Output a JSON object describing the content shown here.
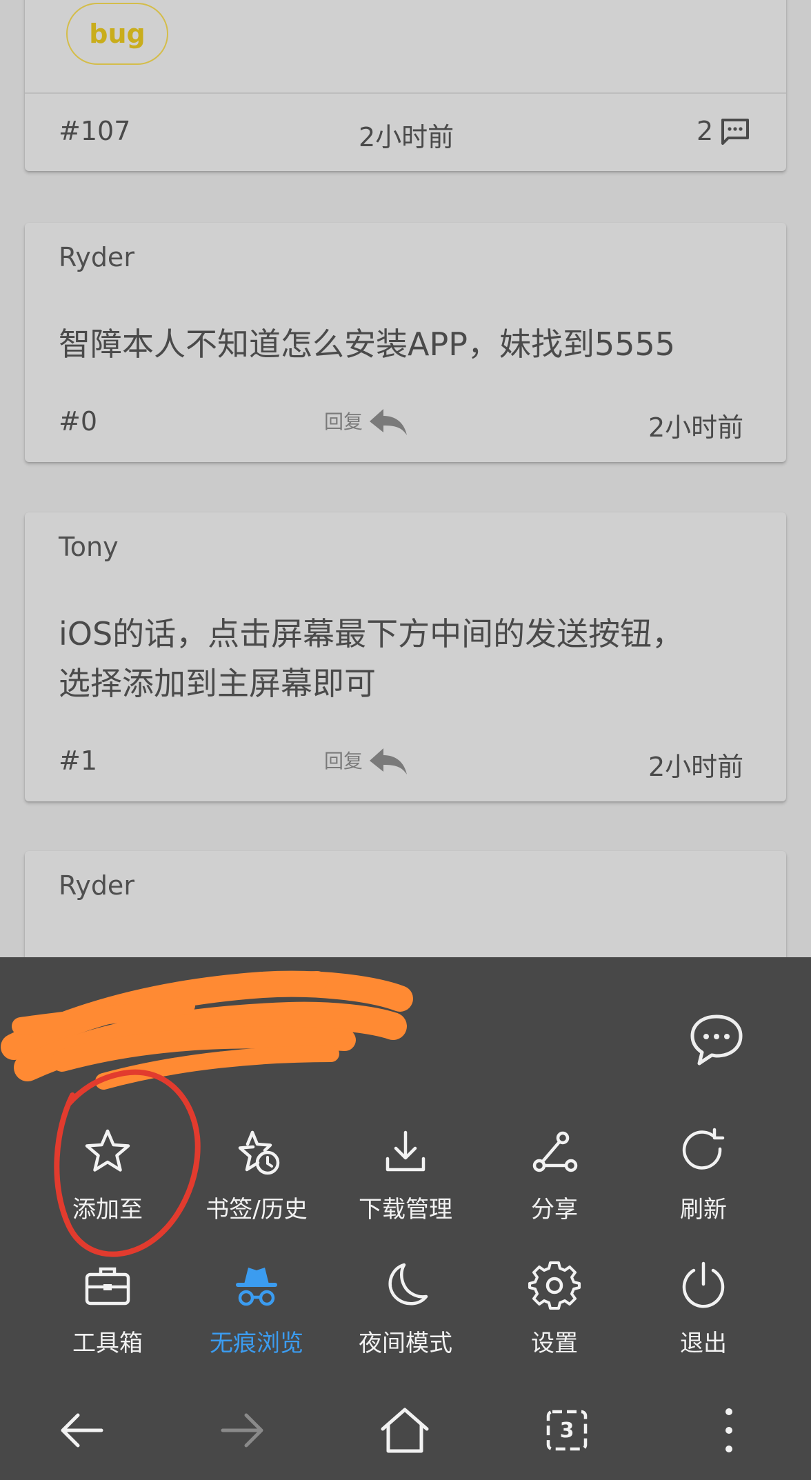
{
  "issue_card": {
    "tag": "bug",
    "number": "#107",
    "time": "2小时前",
    "comments": "2"
  },
  "comments": [
    {
      "author": "Ryder",
      "text_lines": [
        "智障本人不知道怎么安装APP，妹找到5555"
      ],
      "number": "#0",
      "reply_label": "回复",
      "time": "2小时前"
    },
    {
      "author": "Tony",
      "text_lines": [
        "iOS的话，点击屏幕最下方中间的发送按钮，",
        "选择添加到主屏幕即可"
      ],
      "number": "#1",
      "reply_label": "回复",
      "time": "2小时前"
    },
    {
      "author": "Ryder"
    }
  ],
  "menu": {
    "row1": [
      {
        "label": "添加至",
        "icon": "star-icon"
      },
      {
        "label": "书签/历史",
        "icon": "bookmark-history-icon"
      },
      {
        "label": "下载管理",
        "icon": "download-icon"
      },
      {
        "label": "分享",
        "icon": "share-icon"
      },
      {
        "label": "刷新",
        "icon": "refresh-icon"
      }
    ],
    "row2": [
      {
        "label": "工具箱",
        "icon": "toolbox-icon"
      },
      {
        "label": "无痕浏览",
        "icon": "incognito-icon",
        "active": true
      },
      {
        "label": "夜间模式",
        "icon": "moon-icon"
      },
      {
        "label": "设置",
        "icon": "gear-icon"
      },
      {
        "label": "退出",
        "icon": "power-icon"
      }
    ]
  },
  "toolbar": {
    "tab_count": "3"
  },
  "colors": {
    "accent": "#3b9cf0",
    "tag": "#c9ad1c",
    "sheet": "#484848",
    "annotation_circle": "#e23b2e",
    "redaction": "#ff8a33"
  }
}
